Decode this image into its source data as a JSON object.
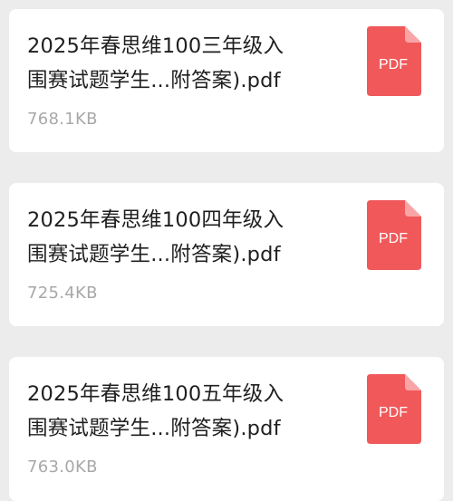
{
  "files": [
    {
      "name_line1": "2025年春思维100三年级入",
      "name_line2": "围赛试题学生...附答案).pdf",
      "size": "768.1KB",
      "icon_label": "PDF",
      "icon": "pdf-file-icon"
    },
    {
      "name_line1": "2025年春思维100四年级入",
      "name_line2": "围赛试题学生...附答案).pdf",
      "size": "725.4KB",
      "icon_label": "PDF",
      "icon": "pdf-file-icon"
    },
    {
      "name_line1": "2025年春思维100五年级入",
      "name_line2": "围赛试题学生...附答案).pdf",
      "size": "763.0KB",
      "icon_label": "PDF",
      "icon": "pdf-file-icon"
    }
  ],
  "colors": {
    "background": "#ececec",
    "card": "#ffffff",
    "pdf_icon": "#f0585a",
    "pdf_fold": "#f9a5a5",
    "title_text": "#1f1f1f",
    "size_text": "#a8a8a8"
  }
}
